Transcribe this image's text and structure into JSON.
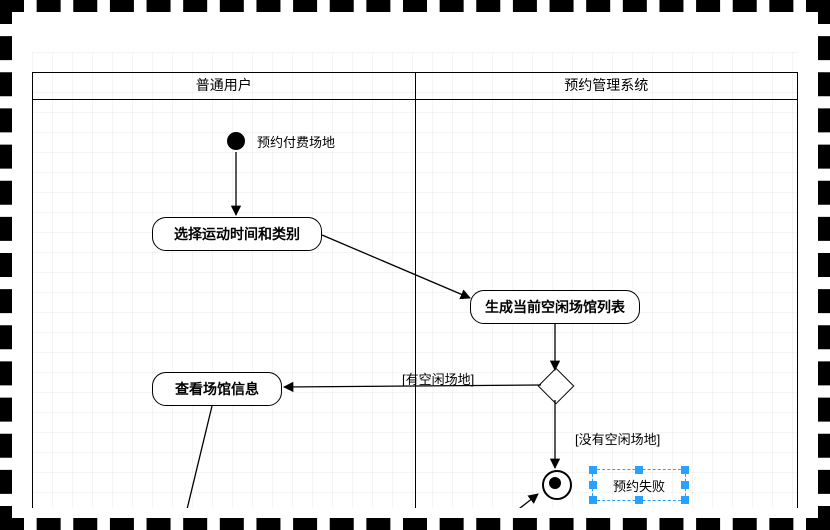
{
  "diagram_type": "uml_activity",
  "lanes": {
    "left": "普通用户",
    "right": "预约管理系统"
  },
  "start": {
    "label": "预约付费场地"
  },
  "activities": {
    "select_time": "选择运动时间和类别",
    "gen_list": "生成当前空闲场馆列表",
    "view_info": "查看场馆信息"
  },
  "guards": {
    "has_free": "[有空闲场地]",
    "no_free": "[没有空闲场地]"
  },
  "end_label": "预约失败",
  "colors": {
    "selection": "#2aa0ff"
  }
}
